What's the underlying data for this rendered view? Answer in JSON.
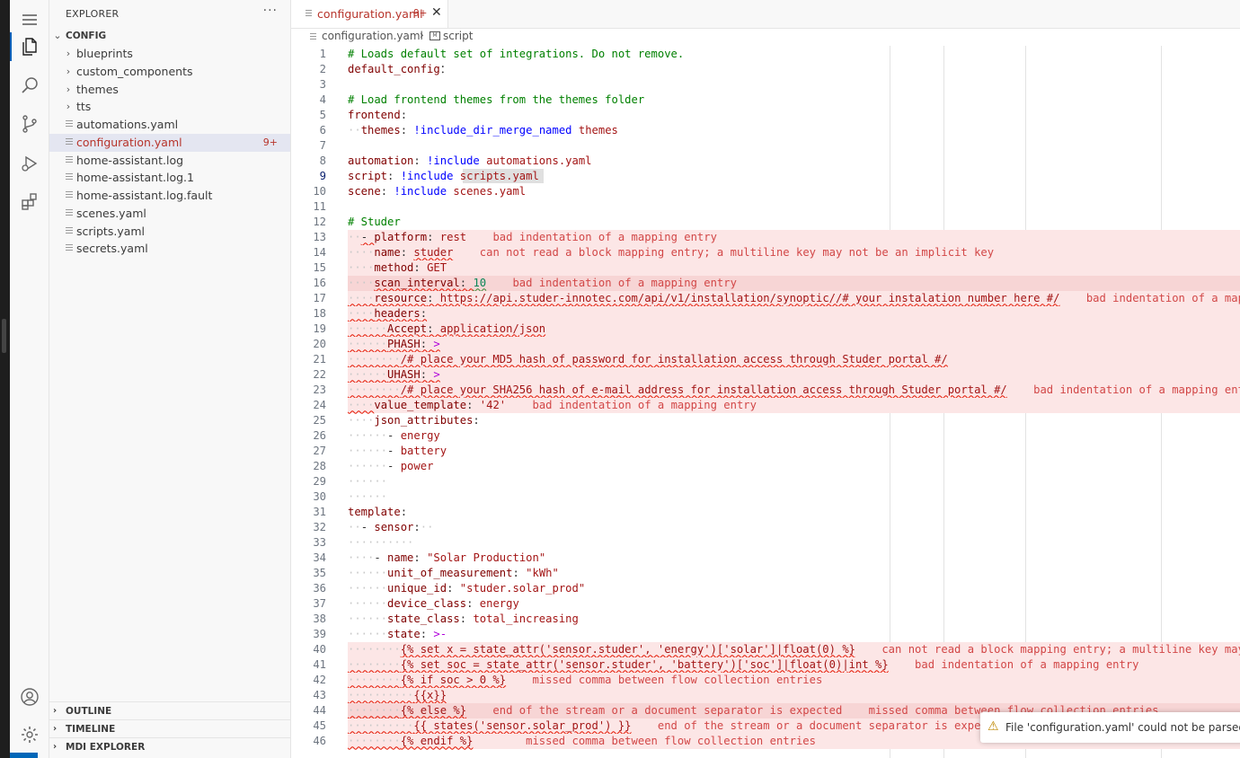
{
  "sidebar": {
    "title": "EXPLORER",
    "more": "···",
    "folder": "CONFIG",
    "items": [
      {
        "label": "blueprints",
        "kind": "folder"
      },
      {
        "label": "custom_components",
        "kind": "folder"
      },
      {
        "label": "themes",
        "kind": "folder"
      },
      {
        "label": "tts",
        "kind": "folder"
      },
      {
        "label": "automations.yaml",
        "kind": "file"
      },
      {
        "label": "configuration.yaml",
        "kind": "file",
        "badge": "9+"
      },
      {
        "label": "home-assistant.log",
        "kind": "file"
      },
      {
        "label": "home-assistant.log.1",
        "kind": "file"
      },
      {
        "label": "home-assistant.log.fault",
        "kind": "file"
      },
      {
        "label": "scenes.yaml",
        "kind": "file"
      },
      {
        "label": "scripts.yaml",
        "kind": "file"
      },
      {
        "label": "secrets.yaml",
        "kind": "file"
      }
    ],
    "sections": [
      "OUTLINE",
      "TIMELINE",
      "MDI EXPLORER"
    ]
  },
  "tab": {
    "title": "configuration.yaml",
    "badge": "9+",
    "close": "✕"
  },
  "breadcrumb": {
    "file": "configuration.yaml",
    "sep": "›",
    "symbol": "script",
    "symbol_icon": "mdi-icon"
  },
  "editor": {
    "lines": [
      {
        "n": "1",
        "t": [
          [
            "c",
            "# Loads default set of integrations. Do not remove."
          ]
        ]
      },
      {
        "n": "2",
        "t": [
          [
            "k",
            "default_config"
          ],
          [
            "",
            "："
          ]
        ]
      },
      {
        "n": "3",
        "t": []
      },
      {
        "n": "4",
        "t": [
          [
            "c",
            "# Load frontend themes from the themes folder"
          ]
        ]
      },
      {
        "n": "5",
        "t": [
          [
            "k",
            "frontend"
          ],
          [
            "",
            ":"
          ]
        ]
      },
      {
        "n": "6",
        "t": [
          [
            "ws",
            "··"
          ],
          [
            "k",
            "themes"
          ],
          [
            "",
            ": "
          ],
          [
            "tg",
            "!include_dir_merge_named"
          ],
          [
            "s",
            " themes"
          ]
        ]
      },
      {
        "n": "7",
        "t": []
      },
      {
        "n": "8",
        "t": [
          [
            "k",
            "automation"
          ],
          [
            "",
            ": "
          ],
          [
            "tg",
            "!include"
          ],
          [
            "s",
            " automations.yaml"
          ]
        ]
      },
      {
        "n": "9",
        "t": [
          [
            "k",
            "script"
          ],
          [
            "",
            ": "
          ],
          [
            "tg",
            "!include"
          ],
          [
            "s",
            " scripts.yaml"
          ]
        ]
      },
      {
        "n": "10",
        "t": [
          [
            "k",
            "scene"
          ],
          [
            "",
            ": "
          ],
          [
            "tg",
            "!include"
          ],
          [
            "s",
            " scenes.yaml"
          ]
        ]
      },
      {
        "n": "11",
        "t": []
      },
      {
        "n": "12",
        "t": [
          [
            "c",
            "# Studer"
          ]
        ]
      },
      {
        "n": "13",
        "err": 1,
        "t": [
          [
            "ws",
            "··"
          ],
          [
            "sq",
            "- "
          ],
          [
            "k",
            "platform"
          ],
          [
            "",
            ": "
          ],
          [
            "s",
            "rest"
          ],
          [
            "e",
            "    bad indentation of a mapping entry"
          ]
        ]
      },
      {
        "n": "14",
        "err": 1,
        "t": [
          [
            "ws",
            "····"
          ],
          [
            "k",
            "name"
          ],
          [
            "",
            ": "
          ],
          [
            "s sq",
            "studer"
          ],
          [
            "e",
            "    can not read a block mapping entry; a multiline key may not be an implicit key"
          ]
        ]
      },
      {
        "n": "15",
        "err": 1,
        "t": [
          [
            "ws",
            "····"
          ],
          [
            "k",
            "method"
          ],
          [
            "",
            ": "
          ],
          [
            "s",
            "GET"
          ]
        ]
      },
      {
        "n": "16",
        "err": 2,
        "t": [
          [
            "ws",
            "····"
          ],
          [
            "k sq",
            "scan_interval"
          ],
          [
            "sq",
            ": "
          ],
          [
            "n sqg",
            "10"
          ],
          [
            "e",
            "    bad indentation of a mapping entry"
          ]
        ]
      },
      {
        "n": "17",
        "err": 1,
        "t": [
          [
            "ws sq",
            "····"
          ],
          [
            "k sq",
            "resource"
          ],
          [
            "sq",
            ": "
          ],
          [
            "s sq",
            "https://api.studer-innotec.com/api/v1/installation/synoptic//# your instalation number here #/"
          ],
          [
            "e",
            "    bad indentation of a mapping entry"
          ]
        ]
      },
      {
        "n": "18",
        "err": 1,
        "t": [
          [
            "ws sq",
            "····"
          ],
          [
            "k sq",
            "headers"
          ],
          [
            "sq",
            ":"
          ]
        ]
      },
      {
        "n": "19",
        "err": 1,
        "t": [
          [
            "ws sq",
            "······"
          ],
          [
            "k sq",
            "Accept"
          ],
          [
            "sq",
            ": "
          ],
          [
            "s sq",
            "application/json"
          ]
        ]
      },
      {
        "n": "20",
        "err": 1,
        "t": [
          [
            "ws sq",
            "······"
          ],
          [
            "k sq",
            "PHASH"
          ],
          [
            "sq",
            ": "
          ],
          [
            "p sq",
            ">"
          ]
        ]
      },
      {
        "n": "21",
        "err": 1,
        "t": [
          [
            "ws sq",
            "········"
          ],
          [
            "s sq",
            "/# place your MD5 hash of password for installation access through Studer portal #/"
          ]
        ]
      },
      {
        "n": "22",
        "err": 1,
        "t": [
          [
            "ws sq",
            "······"
          ],
          [
            "k sq",
            "UHASH"
          ],
          [
            "sq",
            ": "
          ],
          [
            "p sq",
            ">"
          ]
        ]
      },
      {
        "n": "23",
        "err": 1,
        "t": [
          [
            "ws sq",
            "········"
          ],
          [
            "s sq",
            "/# place your SHA256 hash of e-mail address for installation access through Studer portal #/"
          ],
          [
            "e",
            "    bad indentation of a mapping entry"
          ]
        ]
      },
      {
        "n": "24",
        "err": 1,
        "t": [
          [
            "ws sq",
            "····"
          ],
          [
            "k",
            "value_template"
          ],
          [
            "",
            ": "
          ],
          [
            "s",
            "'42'"
          ],
          [
            "e",
            "    bad indentation of a mapping entry"
          ]
        ]
      },
      {
        "n": "25",
        "t": [
          [
            "ws",
            "····"
          ],
          [
            "k",
            "json_attributes"
          ],
          [
            "",
            ":"
          ]
        ]
      },
      {
        "n": "26",
        "t": [
          [
            "ws",
            "······"
          ],
          [
            "",
            "- "
          ],
          [
            "s",
            "energy"
          ]
        ]
      },
      {
        "n": "27",
        "t": [
          [
            "ws",
            "······"
          ],
          [
            "",
            "- "
          ],
          [
            "s",
            "battery"
          ]
        ]
      },
      {
        "n": "28",
        "t": [
          [
            "ws",
            "······"
          ],
          [
            "",
            "- "
          ],
          [
            "s",
            "power"
          ]
        ]
      },
      {
        "n": "29",
        "t": [
          [
            "ws",
            "······"
          ]
        ]
      },
      {
        "n": "30",
        "t": [
          [
            "ws",
            "······"
          ]
        ]
      },
      {
        "n": "31",
        "t": [
          [
            "k",
            "template"
          ],
          [
            "",
            ":"
          ]
        ]
      },
      {
        "n": "32",
        "t": [
          [
            "ws",
            "··"
          ],
          [
            "",
            "- "
          ],
          [
            "k",
            "sensor"
          ],
          [
            "",
            ":"
          ],
          [
            "ws",
            "··"
          ]
        ]
      },
      {
        "n": "33",
        "t": [
          [
            "ws",
            "··········"
          ]
        ]
      },
      {
        "n": "34",
        "t": [
          [
            "ws",
            "····"
          ],
          [
            "",
            "- "
          ],
          [
            "k",
            "name"
          ],
          [
            "",
            ": "
          ],
          [
            "s",
            "\"Solar Production\""
          ]
        ]
      },
      {
        "n": "35",
        "t": [
          [
            "ws",
            "······"
          ],
          [
            "k",
            "unit_of_measurement"
          ],
          [
            "",
            ": "
          ],
          [
            "s",
            "\"kWh\""
          ]
        ]
      },
      {
        "n": "36",
        "t": [
          [
            "ws",
            "······"
          ],
          [
            "k",
            "unique_id"
          ],
          [
            "",
            ": "
          ],
          [
            "s",
            "\"studer.solar_prod\""
          ]
        ]
      },
      {
        "n": "37",
        "t": [
          [
            "ws",
            "······"
          ],
          [
            "k",
            "device_class"
          ],
          [
            "",
            ": "
          ],
          [
            "s",
            "energy"
          ]
        ]
      },
      {
        "n": "38",
        "t": [
          [
            "ws",
            "······"
          ],
          [
            "k",
            "state_class"
          ],
          [
            "",
            ": "
          ],
          [
            "s",
            "total_increasing"
          ]
        ]
      },
      {
        "n": "39",
        "t": [
          [
            "ws",
            "······"
          ],
          [
            "k",
            "state"
          ],
          [
            "",
            ": "
          ],
          [
            "p",
            ">-"
          ]
        ]
      },
      {
        "n": "40",
        "err": 1,
        "t": [
          [
            "ws",
            "········"
          ],
          [
            "s sq",
            "{% set x = state_attr('sensor.studer', 'energy')['solar']|float(0) %}"
          ],
          [
            "e",
            "    can not read a block mapping entry; a multiline key may not be an implicit key"
          ]
        ]
      },
      {
        "n": "41",
        "err": 1,
        "t": [
          [
            "ws sq",
            "········"
          ],
          [
            "s sq",
            "{% set soc = state_attr('sensor.studer', 'battery')['soc']|float(0)|int %}"
          ],
          [
            "e",
            "    bad indentation of a mapping entry"
          ]
        ]
      },
      {
        "n": "42",
        "err": 1,
        "t": [
          [
            "ws sq",
            "········"
          ],
          [
            "s sq",
            "{% if soc > 0 %}"
          ],
          [
            "e",
            "    missed comma between flow collection entries"
          ]
        ]
      },
      {
        "n": "43",
        "err": 1,
        "t": [
          [
            "ws sq",
            "··········"
          ],
          [
            "s sq",
            "{{x}}"
          ]
        ]
      },
      {
        "n": "44",
        "err": 2,
        "t": [
          [
            "ws sq",
            "········"
          ],
          [
            "s sq",
            "{% else %}"
          ],
          [
            "e",
            "    end of the stream or a document separator is expected    missed comma between flow collection entries"
          ]
        ]
      },
      {
        "n": "45",
        "err": 1,
        "t": [
          [
            "ws sq",
            "··········"
          ],
          [
            "s sq",
            "{{ states('sensor.solar_prod') }}"
          ],
          [
            "e",
            "    end of the stream or a document separator is expected"
          ]
        ]
      },
      {
        "n": "46",
        "err": 1,
        "t": [
          [
            "ws sq",
            "········"
          ],
          [
            "s sq",
            "{% endif %}"
          ],
          [
            "e",
            "        missed comma between flow collection entries"
          ]
        ]
      }
    ]
  },
  "toast": {
    "icon": "warning-icon",
    "text": "File 'configuration.yaml' could not be parsed, it w"
  },
  "colors": {
    "accent": "#005fb8",
    "error_text": "#b7342b",
    "error_bg": "#fce6e6"
  }
}
